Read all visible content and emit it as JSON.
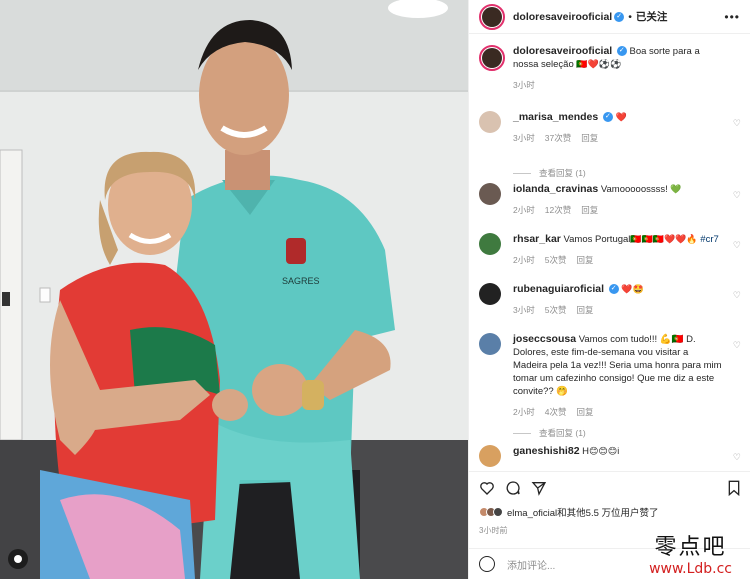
{
  "post": {
    "username": "doloresaveirooficial",
    "follow_state": "已关注",
    "more": "•••",
    "caption_text": "Boa sorte para a nossa seleção",
    "caption_emoji": "🇵🇹❤️⚽⚽",
    "caption_time": "3小时"
  },
  "comments": [
    {
      "user": "_marisa_mendes",
      "verified": true,
      "text": "",
      "emoji": "❤️",
      "time": "3小时",
      "likes": "37次赞",
      "reply": "回复",
      "view_replies": "查看回复 (1)"
    },
    {
      "user": "iolanda_cravinas",
      "verified": false,
      "text": "Vamooooossss!",
      "emoji": "💚",
      "time": "2小时",
      "likes": "12次赞",
      "reply": "回复"
    },
    {
      "user": "rhsar_kar",
      "verified": false,
      "text": "Vamos Portugal",
      "emoji": "🇵🇹🇵🇹🇵🇹❤️❤️🔥",
      "tag": "#cr7",
      "time": "2小时",
      "likes": "5次赞",
      "reply": "回复"
    },
    {
      "user": "rubenaguiaroficial",
      "verified": true,
      "text": "",
      "emoji": "❤️🤩",
      "time": "3小时",
      "likes": "5次赞",
      "reply": "回复"
    },
    {
      "user": "joseccsousa",
      "verified": false,
      "text": "Vamos com tudo!!! 💪🇵🇹 D. Dolores, este fim-de-semana vou visitar a Madeira pela 1a vez!!! Seria uma honra para mim tomar um cafezinho consigo! Que me diz a este convite?? 🤭",
      "time": "2小时",
      "likes": "4次赞",
      "reply": "回复",
      "view_replies": "查看回复 (1)"
    },
    {
      "user": "ganeshishi82",
      "verified": false,
      "text": "H",
      "emoji": "😊😊😊i",
      "time": "",
      "likes": "",
      "reply": ""
    }
  ],
  "liked_by": "elma_oficial和其他5.5 万位用户赞了",
  "post_time": "3小时前",
  "composer_placeholder": "添加评论...",
  "watermark": {
    "line1": "零点吧",
    "line2": "www.Ldb.cc"
  },
  "colors": {
    "verified": "#3897f0",
    "link": "#00376b",
    "muted": "#8e8e8e"
  }
}
